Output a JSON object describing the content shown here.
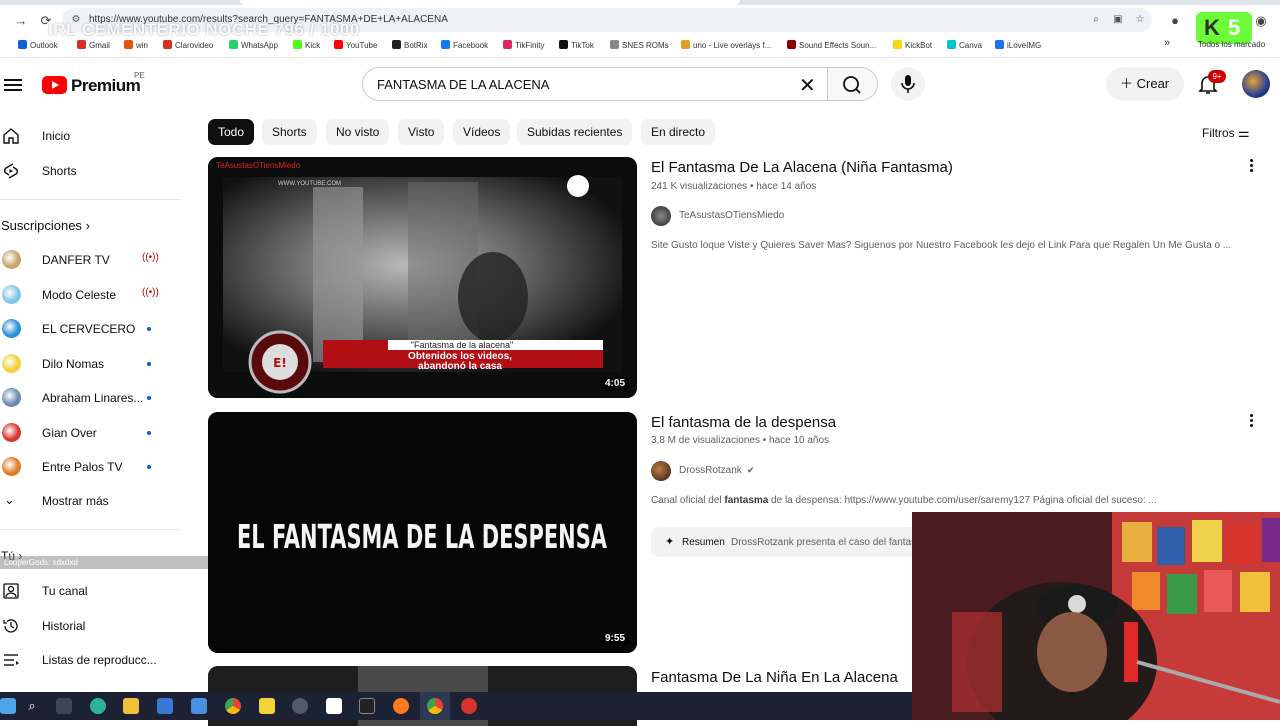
{
  "browser": {
    "url": "https://www.youtube.com/results?search_query=FANTASMA+DE+LA+ALACENA",
    "stream_overlay_title": "IRL CEMENTERIO NOCHE 796 / 1000",
    "kick_count": "5",
    "bookmarks": [
      "Outlook",
      "Gmail",
      "win",
      "Clarovideo",
      "WhatsApp",
      "Kick",
      "YouTube",
      "BotRix",
      "Facebook",
      "TikFinity",
      "TikTok",
      "SNES ROMs",
      "uno - Live overlays f...",
      "Sound Effects Soun...",
      "KickBot",
      "Canva",
      "iLoveIMG"
    ],
    "bookmarks_overflow": "»",
    "all_bookmarks": "Todos los marcado"
  },
  "header": {
    "logo": "Premium",
    "country": "PE",
    "search_value": "FANTASMA DE LA ALACENA",
    "crear": "Crear",
    "notif_badge": "9+"
  },
  "sidebar": {
    "main": [
      {
        "label": "Inicio"
      },
      {
        "label": "Shorts"
      }
    ],
    "subscriptions_title": "Suscripciones",
    "subscriptions": [
      {
        "label": "DANFER TV",
        "status": "live",
        "color": "#c9a46a"
      },
      {
        "label": "Modo Celeste",
        "status": "live",
        "color": "#7ec3ea"
      },
      {
        "label": "EL CERVECERO",
        "status": "new",
        "color": "#2a8fd9"
      },
      {
        "label": "Dilo Nomas",
        "status": "new",
        "color": "#f0d23a"
      },
      {
        "label": "Abraham Linares...",
        "status": "new",
        "color": "#6a8ab0"
      },
      {
        "label": "Gian Over",
        "status": "new",
        "color": "#d8342b"
      },
      {
        "label": "Entre Palos TV",
        "status": "new",
        "color": "#e07a25"
      }
    ],
    "mostrar_mas": "Mostrar más",
    "tu_title": "Tú",
    "overlay_chat": "LooperGods: xdxdxd",
    "tu_items": [
      {
        "label": "Tu canal"
      },
      {
        "label": "Historial"
      },
      {
        "label": "Listas de reproducc..."
      }
    ]
  },
  "chips": [
    "Todo",
    "Shorts",
    "No visto",
    "Visto",
    "Vídeos",
    "Subidas recientes",
    "En directo"
  ],
  "filtros": "Filtros",
  "results": [
    {
      "title": "El Fantasma De La Alacena (Niña Fantasma)",
      "meta": "241 K visualizaciones • hace 14 años",
      "channel": "TeAsustasOTiensMiedo",
      "verified": false,
      "description": "Site Gusto loque Viste y Quieres Saver Mas? Siguenos por Nuestro Facebook les dejo el Link Para que Regalen Un Me Gusta o ...",
      "duration": "4:05",
      "thumb_caption_1": "\"Fantasma de la alacena\"",
      "thumb_caption_2": "Obtenidos los videos,",
      "thumb_caption_3": "abandonó la casa",
      "thumb_watermark": "TeAsustasOTiensMiedo",
      "thumb_site": "WWW.YOUTUBE.COM"
    },
    {
      "title": "El fantasma de la despensa",
      "meta": "3,8 M de visualizaciones • hace 10 años",
      "channel": "DrossRotzank",
      "verified": true,
      "description_pre": "Canal oficial del ",
      "description_bold": "fantasma",
      "description_post": " de la despensa: https://www.youtube.com/user/saremy127 Página oficial del suceso: ...",
      "resumen_label": "Resumen",
      "resumen_text": "DrossRotzank presenta el caso del fantasma",
      "duration": "9:55",
      "thumb_text": "EL FANTASMA DE LA DESPENSA"
    },
    {
      "title": "Fantasma De La Niña En La Alacena"
    }
  ]
}
